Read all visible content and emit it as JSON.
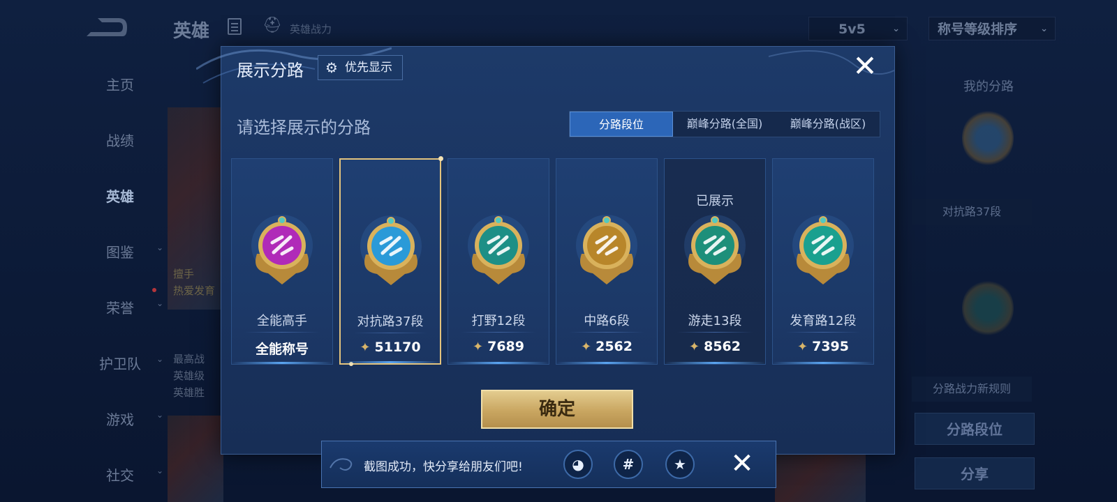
{
  "background": {
    "title": "英雄",
    "power_label": "英雄战力",
    "mode_select": "5v5",
    "sort_select": "称号等级排序",
    "sidebar": [
      {
        "label": "主页"
      },
      {
        "label": "战绩"
      },
      {
        "label": "英雄"
      },
      {
        "label": "图鉴"
      },
      {
        "label": "荣誉"
      },
      {
        "label": "护卫队"
      },
      {
        "label": "游戏"
      },
      {
        "label": "社交"
      }
    ],
    "card_text": [
      "擅手",
      "热爱发育",
      "最高战",
      "英雄级",
      "英雄胜"
    ],
    "right": {
      "title": "我的分路",
      "badge": "对抗路37段",
      "rule": "分路战力新规则",
      "lane_btn": "分路段位",
      "share_btn": "分享"
    }
  },
  "modal": {
    "title": "展示分路",
    "priority_btn": "优先显示",
    "subtitle": "请选择展示的分路",
    "tabs": [
      "分路段位",
      "巅峰分路(全国)",
      "巅峰分路(战区)"
    ],
    "active_tab": 0,
    "cards": [
      {
        "name": "全能高手",
        "score": "全能称号",
        "shown": "",
        "color": "#b02ab8",
        "icon": "all-round-emblem-icon"
      },
      {
        "name": "对抗路37段",
        "score": "51170",
        "shown": "",
        "color": "#2a9ad8",
        "icon": "clash-lane-emblem-icon"
      },
      {
        "name": "打野12段",
        "score": "7689",
        "shown": "",
        "color": "#1d8f86",
        "icon": "jungle-emblem-icon"
      },
      {
        "name": "中路6段",
        "score": "2562",
        "shown": "",
        "color": "#b8862a",
        "icon": "mid-lane-emblem-icon"
      },
      {
        "name": "游走13段",
        "score": "8562",
        "shown": "已展示",
        "color": "#1d8f7a",
        "icon": "roam-emblem-icon"
      },
      {
        "name": "发育路12段",
        "score": "7395",
        "shown": "",
        "color": "#1aa08f",
        "icon": "farm-lane-emblem-icon"
      }
    ],
    "selected_card": 1,
    "confirm_btn": "确定"
  },
  "toast": {
    "text": "截图成功，快分享给朋友们吧!",
    "icons": [
      "qq-icon",
      "hashtag-icon",
      "qzone-star-icon"
    ],
    "icon_glyphs": [
      "◕",
      "#",
      "★"
    ]
  },
  "colors": {
    "accent": "#2c66b8",
    "gold": "#e3c37d",
    "modal_bg": "#1a3460"
  }
}
